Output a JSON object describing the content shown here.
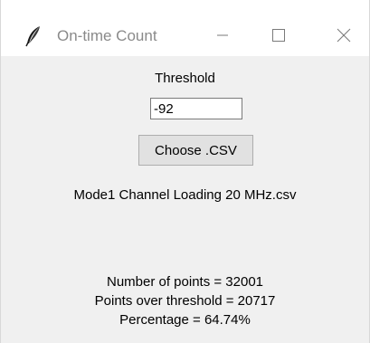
{
  "window": {
    "title": "On-time Count",
    "icons": {
      "app": "feather-icon",
      "minimize": "minimize-icon",
      "maximize": "maximize-icon",
      "close": "close-icon"
    },
    "colors": {
      "titlebar_bg": "#ffffff",
      "client_bg": "#f0f0f0",
      "title_text": "#8a8a8a"
    }
  },
  "form": {
    "threshold_label": "Threshold",
    "threshold_value": "-92",
    "choose_button_label": "Choose .CSV",
    "selected_file": "Mode1 Channel Loading 20 MHz.csv"
  },
  "results": {
    "number_of_points": "Number of points = 32001",
    "points_over_threshold": "Points over threshold = 20717",
    "percentage": "Percentage = 64.74%"
  }
}
